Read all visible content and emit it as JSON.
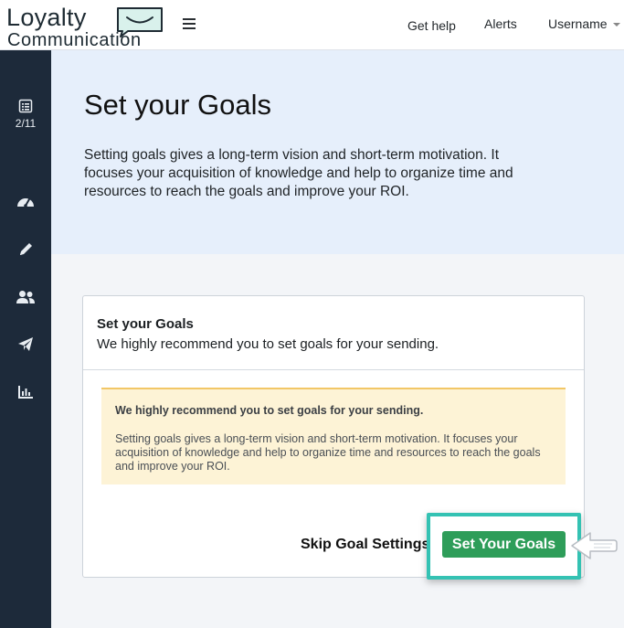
{
  "brand": {
    "line1": "Loyalty",
    "line2": "Communication"
  },
  "header": {
    "get_help": "Get help",
    "alerts": "Alerts",
    "username": "Username"
  },
  "sidebar": {
    "step": "2/11",
    "items": [
      {
        "icon": "checklist-icon"
      },
      {
        "icon": "dashboard-gauge-icon"
      },
      {
        "icon": "pencil-icon"
      },
      {
        "icon": "users-icon"
      },
      {
        "icon": "paper-plane-icon"
      },
      {
        "icon": "bar-chart-icon"
      }
    ]
  },
  "hero": {
    "title": "Set your Goals",
    "text": "Setting goals gives a long-term vision and short-term motivation. It focuses your acquisition of knowledge and help to organize time and resources to reach the goals and improve your ROI."
  },
  "card": {
    "title": "Set your Goals",
    "subtitle": "We highly recommend you to set goals for your sending.",
    "alert_title": "We highly recommend you to set goals for your sending.",
    "alert_text": "Setting goals gives a long-term vision and short-term motivation. It focuses your acquisition of knowledge and help to organize time and resources to reach the goals and improve your ROI.",
    "skip_label": "Skip Goal Settings",
    "primary_label": "Set Your Goals"
  },
  "colors": {
    "sidebar": "#1d2a3a",
    "hero": "#e6effb",
    "primary": "#2e9d59",
    "highlight": "#34c2b3",
    "alert_bg": "#fdf3d6"
  }
}
